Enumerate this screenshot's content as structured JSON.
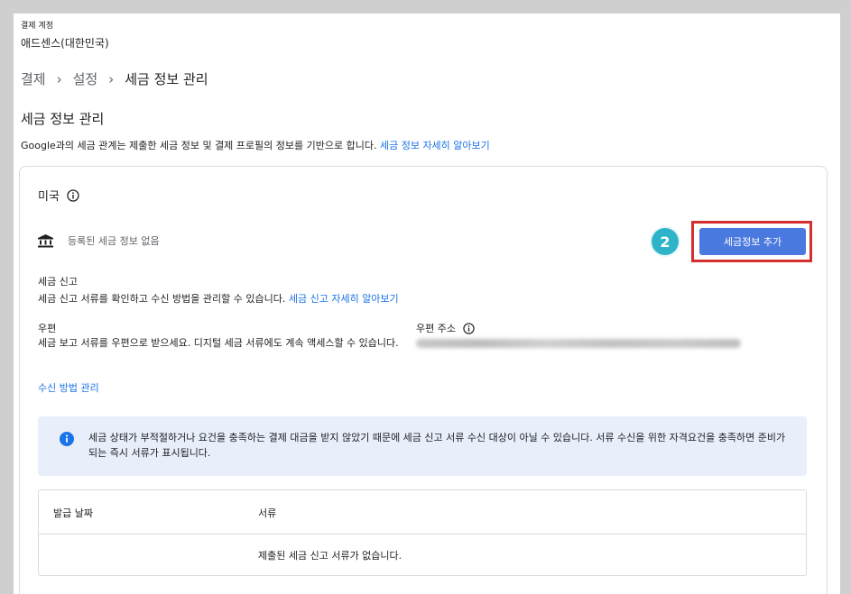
{
  "account": {
    "label": "결제 계정",
    "name": "애드센스(대한민국)"
  },
  "breadcrumb": {
    "items": [
      "결제",
      "설정",
      "세금 정보 관리"
    ],
    "separator": "›"
  },
  "page": {
    "title": "세금 정보 관리",
    "intro_text": "Google과의 세금 관계는 제출한 세금 정보 및 결제 프로필의 정보를 기반으로 합니다.",
    "intro_link": "세금 정보 자세히 알아보기"
  },
  "card": {
    "country": "미국",
    "bank_status": "등록된 세금 정보 없음",
    "step_number": "2",
    "add_button_label": "세금정보 추가",
    "tax_filing": {
      "title": "세금 신고",
      "desc": "세금 신고 서류를 확인하고 수신 방법을 관리할 수 있습니다.",
      "link": "세금 신고 자세히 알아보기"
    },
    "mail": {
      "label": "우편",
      "desc": "세금 보고 서류를 우편으로 받으세요. 디지털 세금 서류에도 계속 액세스할 수 있습니다."
    },
    "mail_address": {
      "label": "우편 주소"
    },
    "manage_link": "수신 방법 관리",
    "notice": "세금 상태가 부적절하거나 요건을 충족하는 결제 대금을 받지 않았기 때문에 세금 신고 서류 수신 대상이 아닐 수 있습니다. 서류 수신을 위한 자격요건을 충족하면 준비가 되는 즉시 서류가 표시됩니다.",
    "table": {
      "columns": [
        "발급 날짜",
        "서류"
      ],
      "empty_message": "제출된 세금 신고 서류가 없습니다."
    }
  },
  "colors": {
    "accent": "#1a73e8",
    "button": "#4a79e0",
    "highlight": "#d32f2f",
    "step_badge": "#2fb3c8",
    "notice_bg": "#e8eefa"
  }
}
